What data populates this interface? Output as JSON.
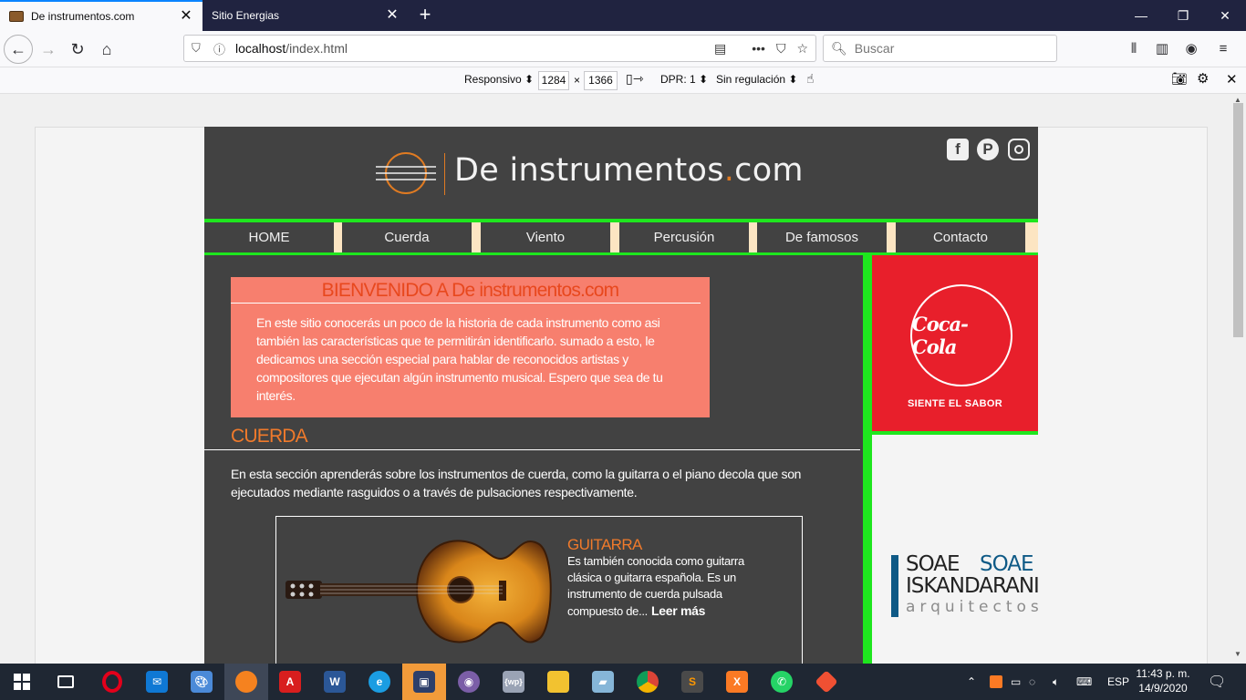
{
  "browser": {
    "tabs": [
      {
        "title": "De instrumentos.com",
        "active": true
      },
      {
        "title": "Sitio Energias",
        "active": false
      }
    ],
    "url_host": "localhost",
    "url_path": "/index.html",
    "search_placeholder": "Buscar",
    "icons": [
      "back-icon",
      "forward-icon",
      "reload-icon",
      "home-icon",
      "shield-icon",
      "page-info-icon",
      "reader-icon",
      "more-icon",
      "pocket-icon",
      "bookmark-star-icon",
      "search-icon",
      "library-icon",
      "sidebar-icon",
      "account-icon",
      "menu-icon"
    ]
  },
  "rdm": {
    "device": "Responsivo",
    "width": "1284",
    "times": "×",
    "height": "1366",
    "dpr": "DPR: 1",
    "throttle": "Sin regulación"
  },
  "site": {
    "logo_main": "De instrumentos",
    "logo_dot": ".",
    "logo_tld": "com",
    "social": [
      "facebook-icon",
      "pinterest-icon",
      "instagram-icon"
    ],
    "nav": [
      "HOME",
      "Cuerda",
      "Viento",
      "Percusión",
      "De famosos",
      "Contacto"
    ],
    "welcome_title": "BIENVENIDO A De instrumentos.com",
    "welcome_text": "En este sitio conocerás un poco de la historia de cada instrumento como asi también las características que te permitirán identificarlo. sumado a esto, le dedicamos una sección especial para hablar de reconocidos artistas y compositores que ejecutan algún instrumento musical. Espero que sea de tu interés.",
    "section_title": "CUERDA",
    "section_text": "En esta sección aprenderás sobre los instrumentos de cuerda, como la guitarra o el piano decola que son ejecutados mediante rasguidos o a través de pulsaciones respectivamente.",
    "card_title": "GUITARRA",
    "card_text": "Es también conocida como guitarra clásica o guitarra española. Es un instrumento de cuerda pulsada compuesto de...",
    "card_more": "Leer más",
    "ad_coke_logo": "Coca-Cola",
    "ad_coke_slogan": "SIENTE EL SABOR",
    "ad_soae_1a": "SOAE",
    "ad_soae_1b": "SOAE",
    "ad_soae_2": "ISKANDARANI",
    "ad_soae_3": "arquitectos"
  },
  "taskbar": {
    "lang": "ESP",
    "time": "11:43 p. m.",
    "date": "14/9/2020",
    "apps": [
      "start-icon",
      "task-view-icon",
      "opera-icon",
      "mail-icon",
      "paint-icon",
      "firefox-icon",
      "acrobat-icon",
      "word-icon",
      "edge-icon",
      "image-editor-icon",
      "app-circle-icon",
      "wp-icon",
      "file-explorer-icon",
      "notes-icon",
      "chrome-icon",
      "sublime-icon",
      "xampp-icon",
      "whatsapp-icon",
      "git-icon"
    ]
  },
  "colors": {
    "accent_green": "#1ee61e",
    "site_bg": "#424242",
    "orange": "#f07a2b",
    "welcome_bg": "#f77f6e",
    "coke_red": "#e81f2b",
    "soae_blue": "#0f5a86"
  }
}
